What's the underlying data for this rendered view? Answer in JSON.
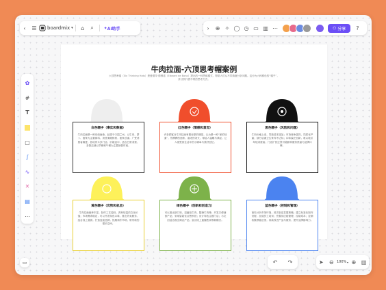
{
  "app": {
    "name": "boardmix",
    "ai_label": "AI助手",
    "share_label": "分享",
    "zoom": "100%"
  },
  "board": {
    "title": "牛肉拉面-六顶思考帽案例",
    "subtitle": "六顶思考帽（Six Thinking Hats）是爱德华·德博诺（Edward de Bono）提出的一种思维模式，帮助人们从不同角度分析问题。这分为六种颜色的“帽子”，并分别代表不同的思考方式。"
  },
  "hats": [
    {
      "name": "白色帽子（事实和数据）",
      "color": "#eeeeee",
      "desc": "牛肉拉面是一种传统面食，起源于中国兰州。以牛肉、萝卜、面条为主要原料，汤底清澈鲜美，面条劲道，广受消费者喜爱，各地有众多门店，价格适中，适合日常消费，多数店铺以早餐和午餐为主要销售时段。"
    },
    {
      "name": "红色帽子（情感和直觉）",
      "color": "#f04e2c",
      "desc": "许多顾客对牛肉拉面有着深厚的情感，认为是一种“家的味道”，热腾腾的面条、香浓的汤头，带给人温暖与满足，让人感受到生活中的小确幸与美好回忆。"
    },
    {
      "name": "黑色帽子（风险和问题）",
      "color": "#111111",
      "desc": "牛肉价格上涨，导致成本增加；市场竞争激烈，同质化严重；部分店铺卫生条件不达标；口味缺乏创新，难以吸引年轻消费者；门店扩张过快可能影响服务质量与品牌口碑。"
    },
    {
      "name": "黄色帽子（优势和机会）",
      "color": "#fdf15a",
      "desc": "牛肉拉面营养丰富，制作工艺独特，具有较高的文化价值；市场需求稳定，可以开发特色口味、推出外卖服务、结合线上营销，打造连锁品牌，拓展海外市场，带来新的增长空间。"
    },
    {
      "name": "绿色帽子（创新和创造力）",
      "color": "#7db24a",
      "desc": "可以推出新口味，如番茄牛肉、酸辣牛肉等；开发方便速食产品；采用智能化点餐系统；设计特色主题门店；与文创结合推出周边产品；尝试线上直播售卖等新模式。"
    },
    {
      "name": "蓝色帽子（控制和管理）",
      "color": "#4b83f0",
      "desc": "首先分析市场环境，其次制定发展策略；建立标准化制作流程，加强员工培训；完善供应链管理，控制成本；定期收集顾客反馈，持续改进产品与服务，提升品牌影响力。"
    }
  ],
  "icons": {
    "toolbar_left": [
      "back-icon",
      "menu-icon",
      "tag-icon",
      "search-icon"
    ],
    "toolbar_right": [
      "collapse-icon",
      "target-icon",
      "magic-icon",
      "comment-icon",
      "timer-icon",
      "presentation-icon",
      "chart-icon",
      "more-icon"
    ],
    "side": [
      "brand-icon",
      "frame-icon",
      "text-icon",
      "sticky-note-icon",
      "shape-icon",
      "pen-icon",
      "line-icon",
      "connector-icon",
      "template-icon",
      "more-icon"
    ]
  }
}
